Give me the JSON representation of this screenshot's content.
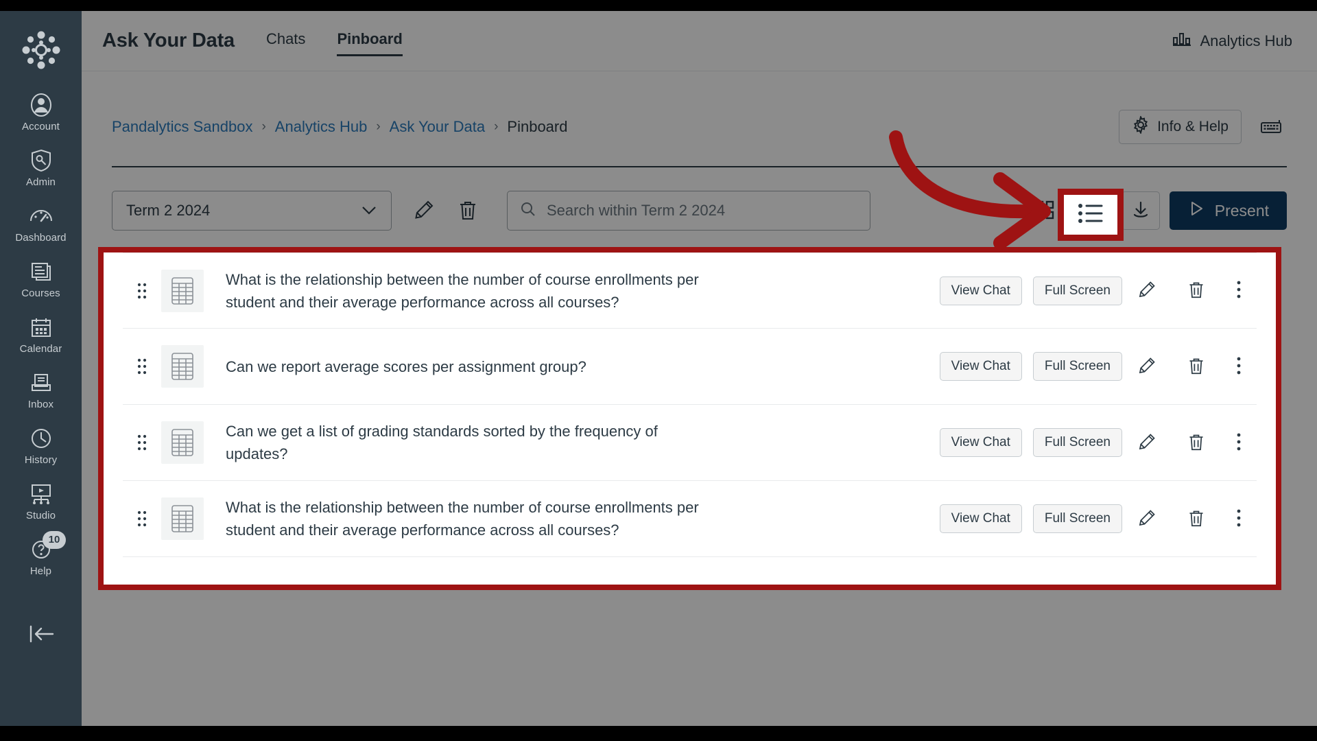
{
  "sidebar": {
    "logo_name": "canvas-logo",
    "items": [
      {
        "label": "Account",
        "icon": "user-circle-icon"
      },
      {
        "label": "Admin",
        "icon": "shield-wrench-icon"
      },
      {
        "label": "Dashboard",
        "icon": "gauge-icon"
      },
      {
        "label": "Courses",
        "icon": "book-icon"
      },
      {
        "label": "Calendar",
        "icon": "calendar-icon"
      },
      {
        "label": "Inbox",
        "icon": "inbox-icon"
      },
      {
        "label": "History",
        "icon": "clock-icon"
      },
      {
        "label": "Studio",
        "icon": "studio-icon"
      },
      {
        "label": "Help",
        "icon": "help-question-icon",
        "badge": "10"
      }
    ],
    "collapse_label": "collapse-nav"
  },
  "header": {
    "title": "Ask Your Data",
    "tabs": [
      {
        "label": "Chats",
        "active": false
      },
      {
        "label": "Pinboard",
        "active": true
      }
    ],
    "hub_label": "Analytics Hub",
    "hub_icon": "bar-chart-icon"
  },
  "breadcrumb": {
    "items": [
      "Pandalytics Sandbox",
      "Analytics Hub",
      "Ask Your Data",
      "Pinboard"
    ],
    "separator": "›"
  },
  "page_actions": {
    "info_help_label": "Info & Help",
    "info_help_icon": "gear-icon",
    "keyboard_icon": "keyboard-icon"
  },
  "toolbar": {
    "term_value": "Term 2 2024",
    "term_caret": "chevron-down-icon",
    "edit_icon": "pencil-icon",
    "delete_icon": "trash-icon",
    "search_placeholder": "Search within Term 2 2024",
    "search_value": "",
    "search_icon": "search-icon",
    "grid_view_icon": "grid-view-icon",
    "list_view_icon": "list-view-icon",
    "download_icon": "download-icon",
    "present_label": "Present",
    "present_icon": "play-triangle-icon",
    "present_color": "#0E3B63"
  },
  "pinboard": {
    "row_button_view_chat": "View Chat",
    "row_button_full_screen": "Full Screen",
    "row_edit_icon": "pencil-icon",
    "row_delete_icon": "trash-icon",
    "row_more_icon": "kebab-menu-icon",
    "drag_icon": "drag-handle-icon",
    "thumb_icon": "table-thumbnail-icon",
    "items": [
      {
        "question": "What is the relationship between the number of course enrollments per student and their average performance across all courses?"
      },
      {
        "question": "Can we report average scores per assignment group?"
      },
      {
        "question": "Can we get a list of grading standards sorted by the frequency of updates?"
      },
      {
        "question": "What is the relationship between the number of course enrollments per student and their average performance across all courses?"
      }
    ]
  },
  "annotation": {
    "color": "#9E1313",
    "arrow_name": "callout-arrow",
    "highlight_toggle_name": "callout-highlight-list-view",
    "highlight_panel_name": "callout-highlight-pinboard-list"
  }
}
